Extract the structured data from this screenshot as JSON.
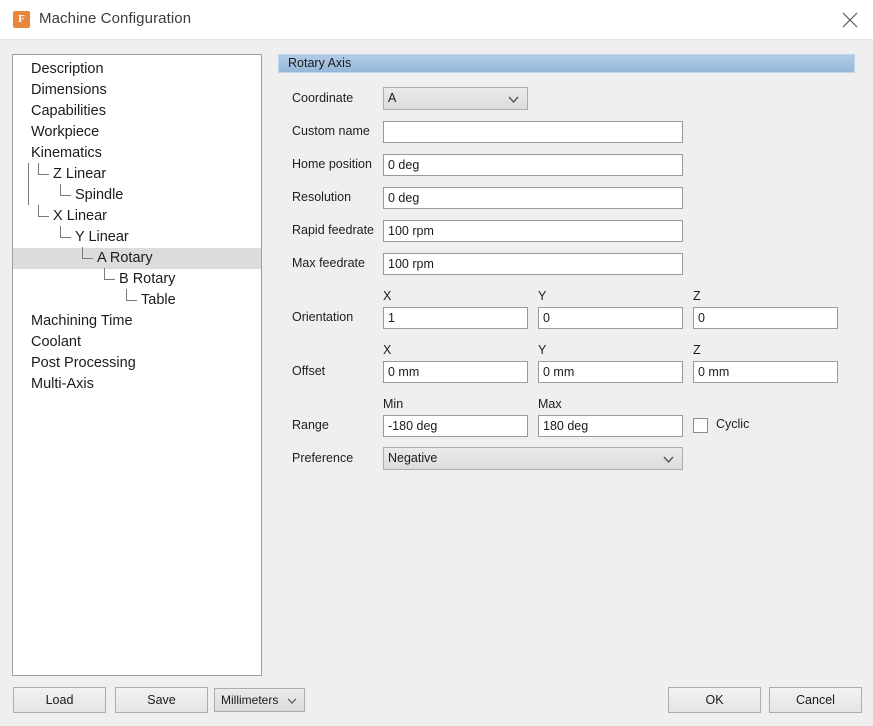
{
  "window": {
    "title": "Machine Configuration",
    "icon": "fusion-app-icon",
    "icon_letter": "F",
    "close_label": "close-icon",
    "accent_header_color": "#95b7da",
    "selection_color": "#dcdcdc"
  },
  "tree": {
    "items": [
      {
        "label": "Description",
        "depth": 0,
        "selected": false,
        "connector": "none"
      },
      {
        "label": "Dimensions",
        "depth": 0,
        "selected": false,
        "connector": "none"
      },
      {
        "label": "Capabilities",
        "depth": 0,
        "selected": false,
        "connector": "none"
      },
      {
        "label": "Workpiece",
        "depth": 0,
        "selected": false,
        "connector": "none"
      },
      {
        "label": "Kinematics",
        "depth": 0,
        "selected": false,
        "connector": "none"
      },
      {
        "label": "Z Linear",
        "depth": 1,
        "selected": false,
        "connector": "tee"
      },
      {
        "label": "Spindle",
        "depth": 2,
        "selected": false,
        "connector": "elbow"
      },
      {
        "label": "X Linear",
        "depth": 1,
        "selected": false,
        "connector": "elbow"
      },
      {
        "label": "Y Linear",
        "depth": 2,
        "selected": false,
        "connector": "elbow"
      },
      {
        "label": "A Rotary",
        "depth": 3,
        "selected": true,
        "connector": "elbow"
      },
      {
        "label": "B Rotary",
        "depth": 4,
        "selected": false,
        "connector": "elbow"
      },
      {
        "label": "Table",
        "depth": 5,
        "selected": false,
        "connector": "elbow"
      },
      {
        "label": "Machining Time",
        "depth": 0,
        "selected": false,
        "connector": "none"
      },
      {
        "label": "Coolant",
        "depth": 0,
        "selected": false,
        "connector": "none"
      },
      {
        "label": "Post Processing",
        "depth": 0,
        "selected": false,
        "connector": "none"
      },
      {
        "label": "Multi-Axis",
        "depth": 0,
        "selected": false,
        "connector": "none"
      }
    ]
  },
  "panel": {
    "header": "Rotary Axis",
    "coordinate": {
      "label": "Coordinate",
      "value": "A"
    },
    "custom_name": {
      "label": "Custom name",
      "value": "",
      "placeholder": ""
    },
    "home_position": {
      "label": "Home position",
      "value": "0 deg"
    },
    "resolution": {
      "label": "Resolution",
      "value": "0 deg"
    },
    "rapid_feedrate": {
      "label": "Rapid feedrate",
      "value": "100 rpm"
    },
    "max_feedrate": {
      "label": "Max feedrate",
      "value": "100 rpm"
    },
    "orientation": {
      "label": "Orientation",
      "col_x": "X",
      "col_y": "Y",
      "col_z": "Z",
      "x": "1",
      "y": "0",
      "z": "0"
    },
    "offset": {
      "label": "Offset",
      "col_x": "X",
      "col_y": "Y",
      "col_z": "Z",
      "x": "0 mm",
      "y": "0 mm",
      "z": "0 mm"
    },
    "range": {
      "label": "Range",
      "col_min": "Min",
      "col_max": "Max",
      "min": "-180 deg",
      "max": "180 deg",
      "cyclic_label": "Cyclic",
      "cyclic_checked": false
    },
    "preference": {
      "label": "Preference",
      "value": "Negative"
    }
  },
  "footer": {
    "load": "Load",
    "save": "Save",
    "units": "Millimeters",
    "ok": "OK",
    "cancel": "Cancel"
  }
}
